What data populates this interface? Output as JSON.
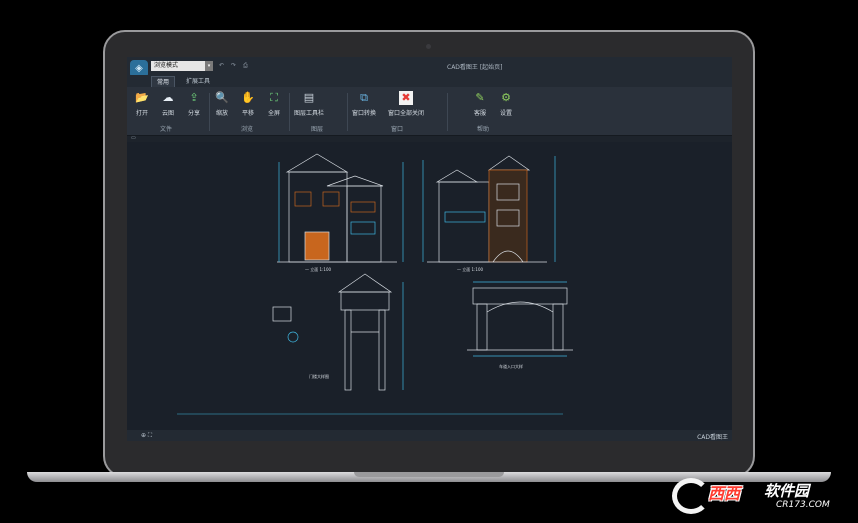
{
  "window": {
    "title": "CAD看图王 [起始页]",
    "mode_select_value": "浏览模式",
    "quick_access": [
      "↶",
      "↷",
      "⎙"
    ]
  },
  "tabs": [
    "常用",
    "扩展工具"
  ],
  "ribbon": {
    "buttons": [
      {
        "label": "打开",
        "icon": "folder-open-icon",
        "glyph": "📂"
      },
      {
        "label": "云图",
        "icon": "cloud-icon",
        "glyph": "☁"
      },
      {
        "label": "分享",
        "icon": "share-icon",
        "glyph": "⇪"
      },
      {
        "label": "缩放",
        "icon": "zoom-icon",
        "glyph": "🔍"
      },
      {
        "label": "平移",
        "icon": "pan-hand-icon",
        "glyph": "✋"
      },
      {
        "label": "全屏",
        "icon": "fullscreen-icon",
        "glyph": "⛶"
      },
      {
        "label": "图层工具栏",
        "icon": "layer-toolbar-icon",
        "glyph": "▤"
      },
      {
        "label": "窗口转换",
        "icon": "window-switch-icon",
        "glyph": "⧉"
      },
      {
        "label": "窗口全部关闭",
        "icon": "close-all-windows-icon",
        "glyph": "✖"
      },
      {
        "label": "客服",
        "icon": "customer-service-icon",
        "glyph": "✎"
      },
      {
        "label": "设置",
        "icon": "settings-gear-icon",
        "glyph": "⚙"
      }
    ],
    "groups": [
      "文件",
      "浏览",
      "图层",
      "窗口",
      "帮助"
    ]
  },
  "drawing_labels": {
    "elevation_front": "一 立面 1:100",
    "elevation_side": "一 立面 1:100",
    "gate_left": "门楼大样图",
    "gate_right": "车道入口大样"
  },
  "status": {
    "brand": "CAD看图王",
    "icons": "⊕ ⛶"
  },
  "watermark": {
    "brand": "西西",
    "cn": "软件园",
    "url": "CR173.COM"
  },
  "colors": {
    "canvas": "#1a2029",
    "drawing_line": "#d8dde3",
    "accent_orange": "#c8661e",
    "dimension_cyan": "#3fb6e0"
  }
}
